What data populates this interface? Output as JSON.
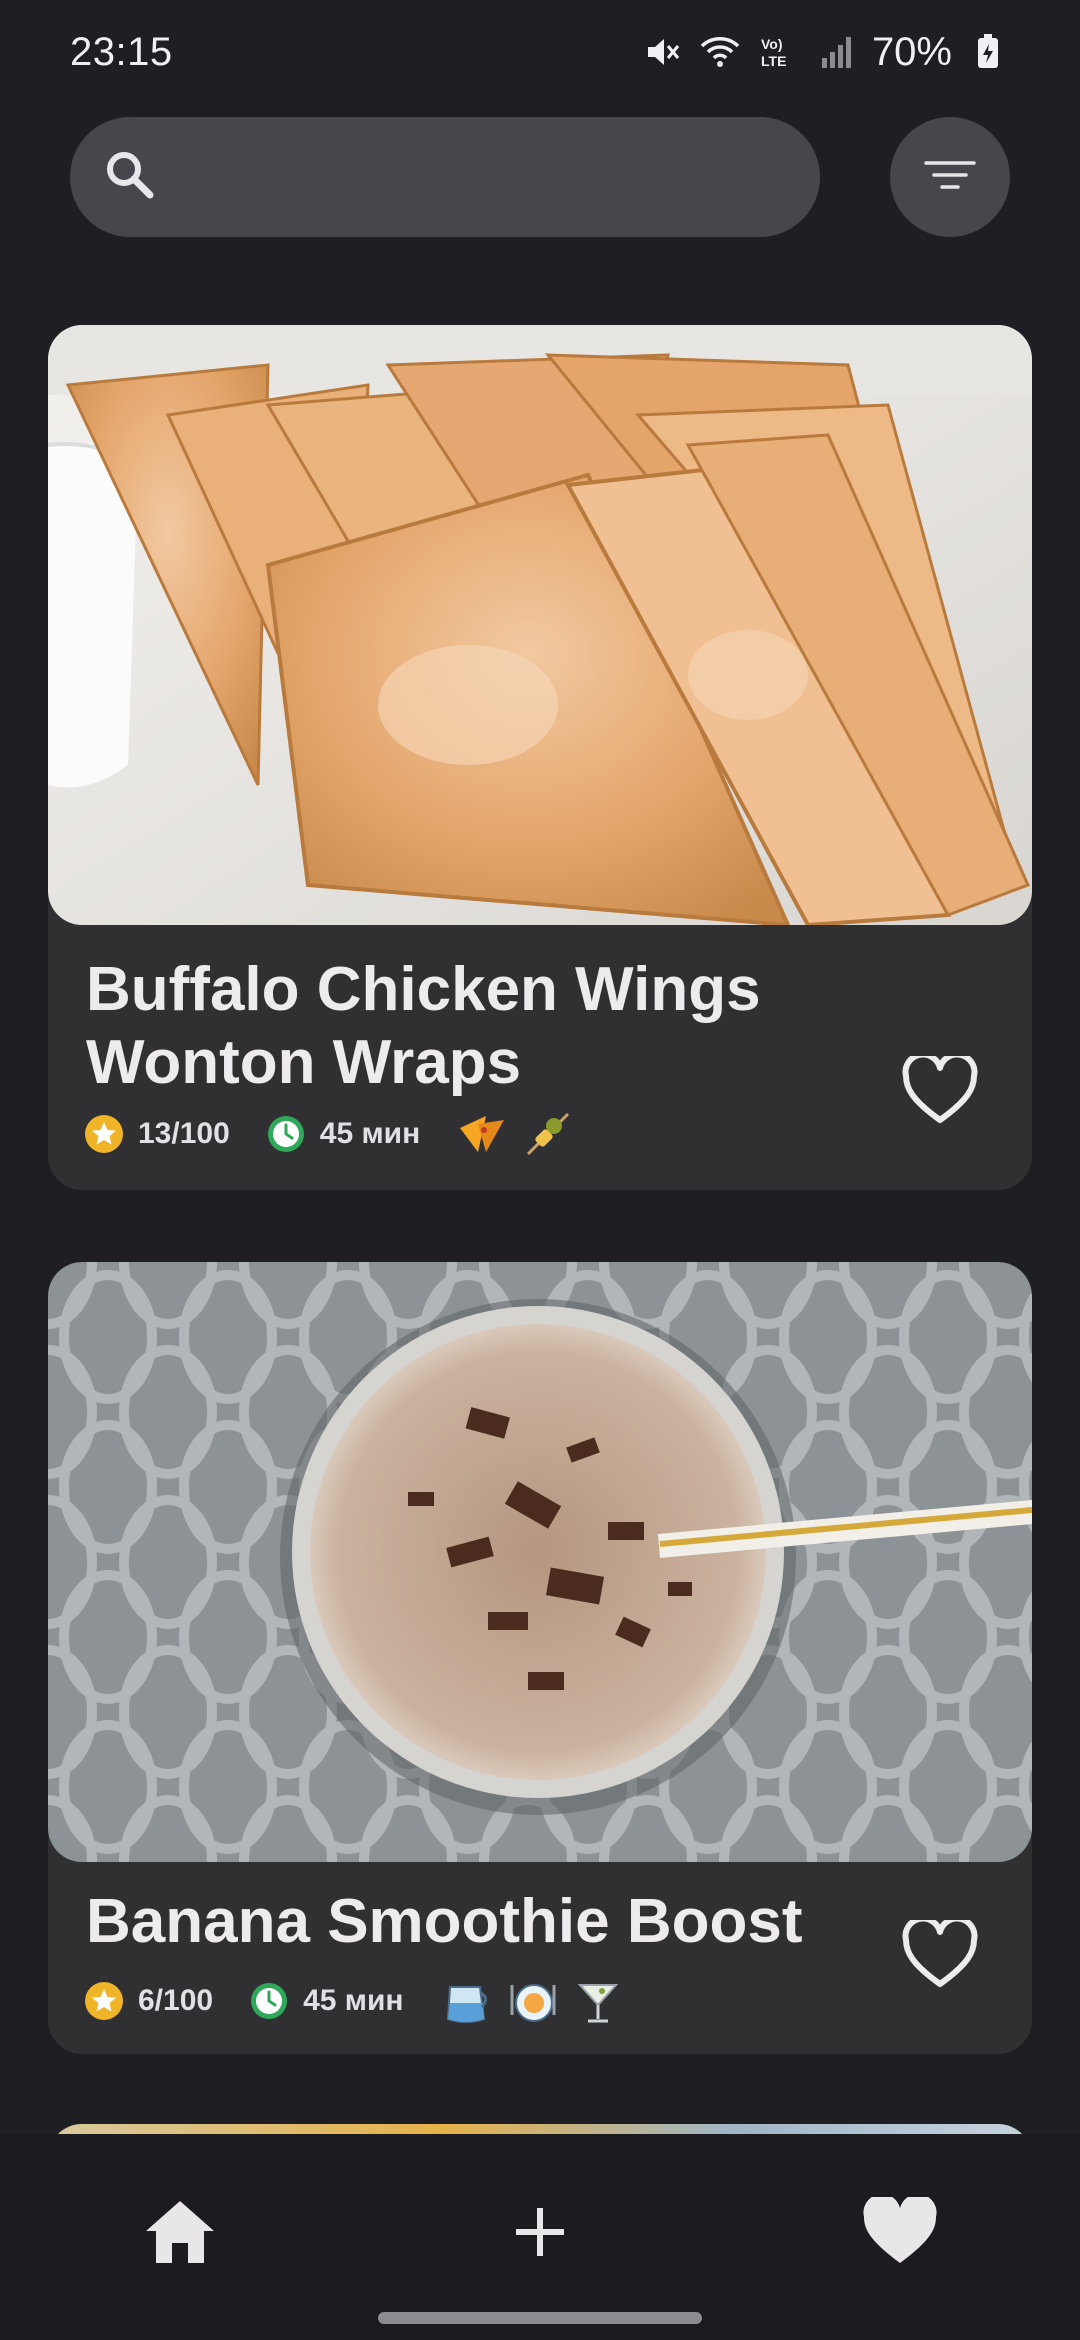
{
  "status_bar": {
    "time": "23:15",
    "battery_percent": "70%",
    "icons": [
      "mute-icon",
      "wifi-icon",
      "volte-icon",
      "signal-icon",
      "battery-icon"
    ]
  },
  "search": {
    "placeholder": "",
    "value": ""
  },
  "filter": {
    "icon": "filter-lines-icon"
  },
  "recipes": [
    {
      "title": "Buffalo Chicken Wings Wonton Wraps",
      "rating": "13/100",
      "time": "45 мин",
      "categories": [
        "nachos-icon",
        "skewer-icon"
      ],
      "favorite": false
    },
    {
      "title": "Banana Smoothie Boost",
      "rating": "6/100",
      "time": "45 мин",
      "categories": [
        "jug-icon",
        "plate-icon",
        "cocktail-icon"
      ],
      "favorite": false
    }
  ],
  "bottom_nav": {
    "items": [
      "home-icon",
      "add-icon",
      "favorites-icon"
    ]
  },
  "colors": {
    "background": "#1f1f23",
    "card": "#303033",
    "search": "#47464d",
    "rating_star": "#f0b429",
    "clock": "#2fa85a"
  }
}
